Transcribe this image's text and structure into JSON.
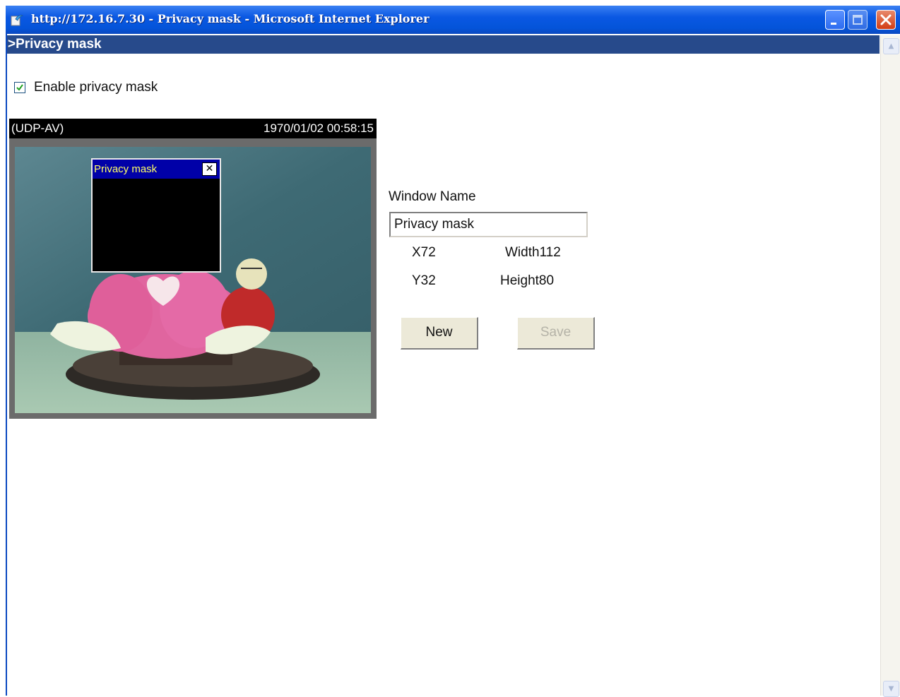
{
  "window": {
    "title": "http://172.16.7.30 - Privacy mask - Microsoft Internet Explorer",
    "title_icon": "ie-page-icon",
    "controls": [
      "minimize-icon",
      "maximize-icon",
      "close-icon"
    ]
  },
  "page": {
    "header": ">Privacy mask",
    "enable_checkbox": {
      "label": "Enable privacy mask",
      "checked": true
    }
  },
  "video": {
    "protocol": "(UDP-AV)",
    "timestamp": "1970/01/02 00:58:15",
    "mask_window": {
      "title": "Privacy mask"
    }
  },
  "form": {
    "window_name_label": "Window Name",
    "window_name_value": "Privacy mask",
    "x_label": "X72",
    "y_label": "Y32",
    "width_label": "Width112",
    "height_label": "Height80",
    "new_button": "New",
    "save_button": "Save",
    "save_enabled": false
  },
  "colors": {
    "titlebar": "#0454d9",
    "header": "#274a8b",
    "mask_titlebar": "#0000a8",
    "mask_title_text": "#ffff66"
  }
}
